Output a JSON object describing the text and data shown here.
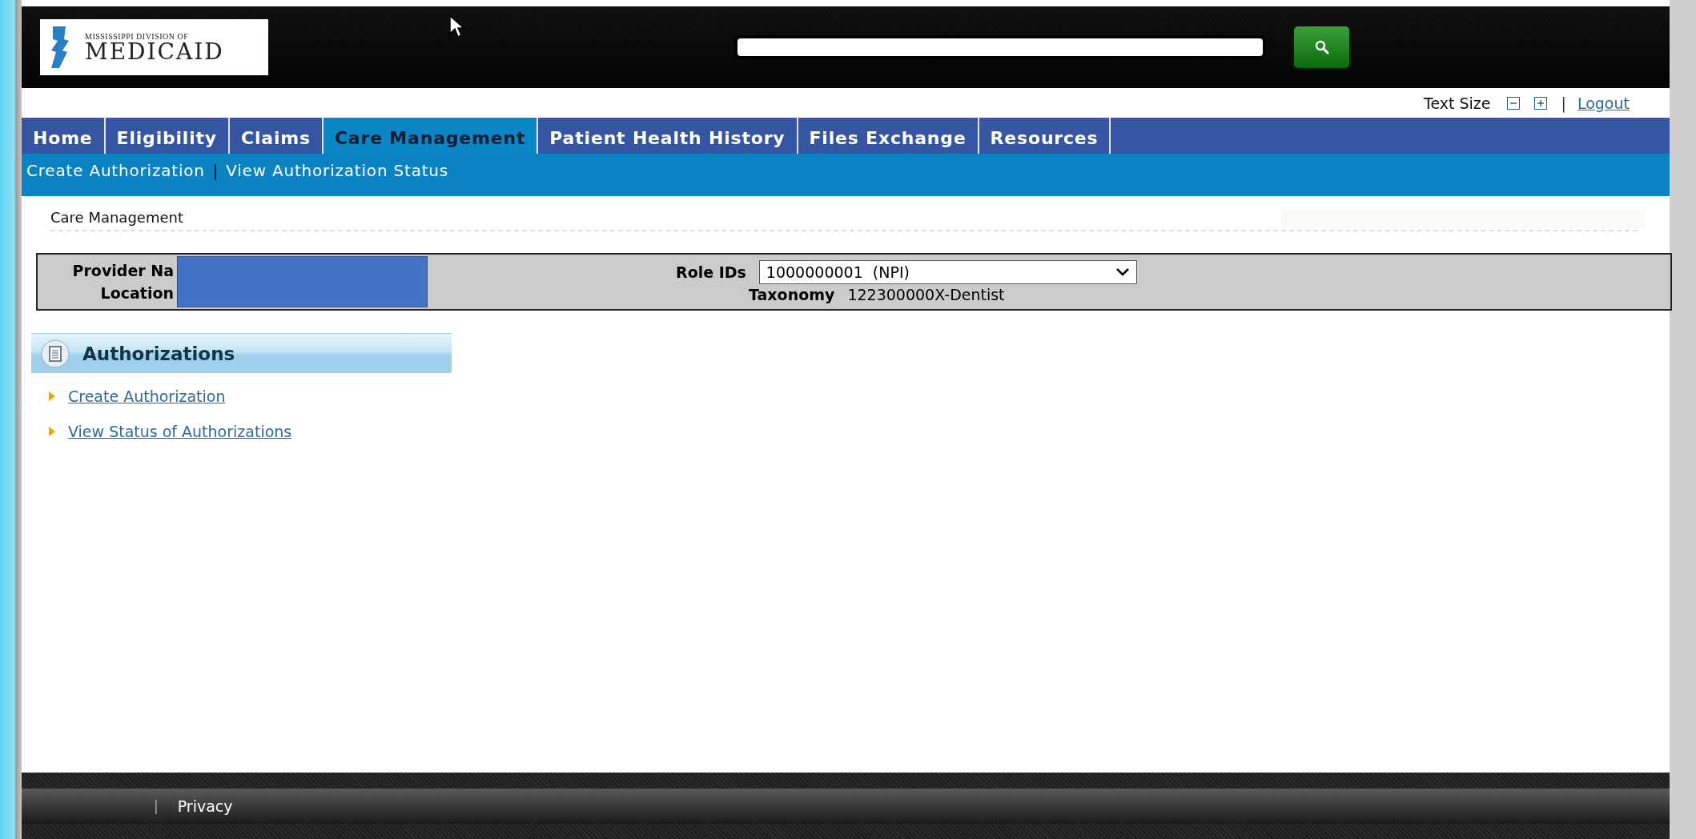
{
  "header": {
    "logo_small": "MISSISSIPPI DIVISION OF",
    "logo_big": "MEDICAID"
  },
  "utility": {
    "text_size_label": "Text Size",
    "separator": "|",
    "logout": "Logout"
  },
  "nav": [
    {
      "label": "Home",
      "selected": false
    },
    {
      "label": "Eligibility",
      "selected": false
    },
    {
      "label": "Claims",
      "selected": false
    },
    {
      "label": "Care Management",
      "selected": true
    },
    {
      "label": "Patient Health History",
      "selected": false
    },
    {
      "label": "Files Exchange",
      "selected": false
    },
    {
      "label": "Resources",
      "selected": false
    }
  ],
  "subnav": {
    "separator": "|",
    "links": [
      "Create Authorization",
      "View Authorization Status"
    ]
  },
  "breadcrumb": "Care Management",
  "provider": {
    "name_label": "Provider Na",
    "location_label": "Location",
    "role_ids_label": "Role IDs",
    "role_id_value": "1000000001  (NPI)",
    "taxonomy_label": "Taxonomy",
    "taxonomy_value": "122300000X-Dentist"
  },
  "authorizations": {
    "title": "Authorizations",
    "links": [
      "Create Authorization",
      "View Status of Authorizations"
    ]
  },
  "footer": {
    "separator": "|",
    "links": [
      "Privacy"
    ]
  }
}
